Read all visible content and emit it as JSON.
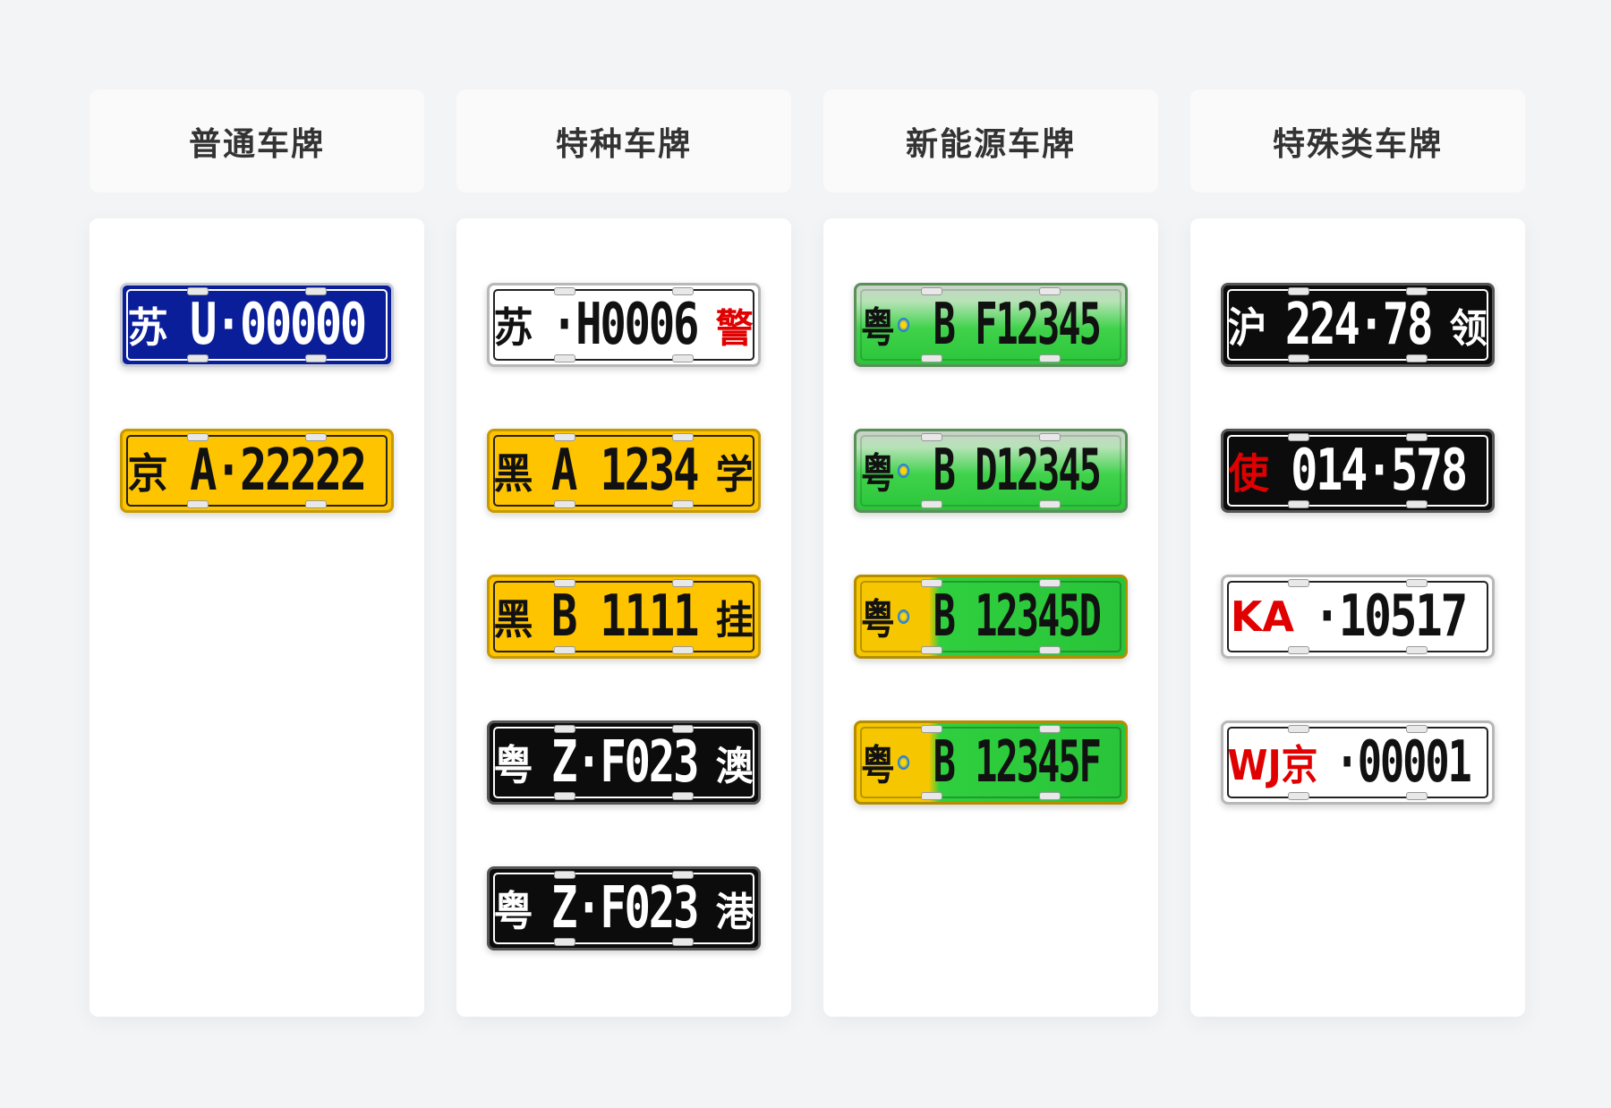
{
  "columns": [
    {
      "title": "普通车牌",
      "plates": [
        {
          "style": "blue",
          "prov": "苏",
          "code": "U·00000",
          "suffix": ""
        },
        {
          "style": "yellow",
          "prov": "京",
          "code": "A·22222",
          "suffix": ""
        }
      ]
    },
    {
      "title": "特种车牌",
      "plates": [
        {
          "style": "white",
          "prov": "苏",
          "code": "·H0006",
          "suffix": "警",
          "suffix_red": true
        },
        {
          "style": "yellow",
          "prov": "黑",
          "code": "A 1234",
          "suffix": "学"
        },
        {
          "style": "yellow",
          "prov": "黑",
          "code": "B 1111",
          "suffix": "挂"
        },
        {
          "style": "black",
          "prov": "粤",
          "code": "Z·F023",
          "suffix": "澳"
        },
        {
          "style": "black",
          "prov": "粤",
          "code": "Z·F023",
          "suffix": "港"
        }
      ]
    },
    {
      "title": "新能源车牌",
      "plates": [
        {
          "style": "green",
          "prov": "粤",
          "code": "B F12345",
          "suffix": "",
          "ev_logo": true
        },
        {
          "style": "green",
          "prov": "粤",
          "code": "B D12345",
          "suffix": "",
          "ev_logo": true
        },
        {
          "style": "ygreen",
          "prov": "粤",
          "code": "B 12345D",
          "suffix": "",
          "ev_logo": true
        },
        {
          "style": "ygreen",
          "prov": "粤",
          "code": "B 12345F",
          "suffix": "",
          "ev_logo": true
        }
      ]
    },
    {
      "title": "特殊类车牌",
      "plates": [
        {
          "style": "black",
          "prov": "沪",
          "code": "224·78",
          "suffix": "领"
        },
        {
          "style": "black",
          "prov": "使",
          "prov_red": true,
          "code": "014·578",
          "suffix": ""
        },
        {
          "style": "white",
          "prov": "",
          "code_red": "KA",
          "code": "·10517",
          "suffix": ""
        },
        {
          "style": "white",
          "prov": "",
          "code_red": "WJ京",
          "code": "·00001",
          "suffix": ""
        }
      ]
    }
  ]
}
